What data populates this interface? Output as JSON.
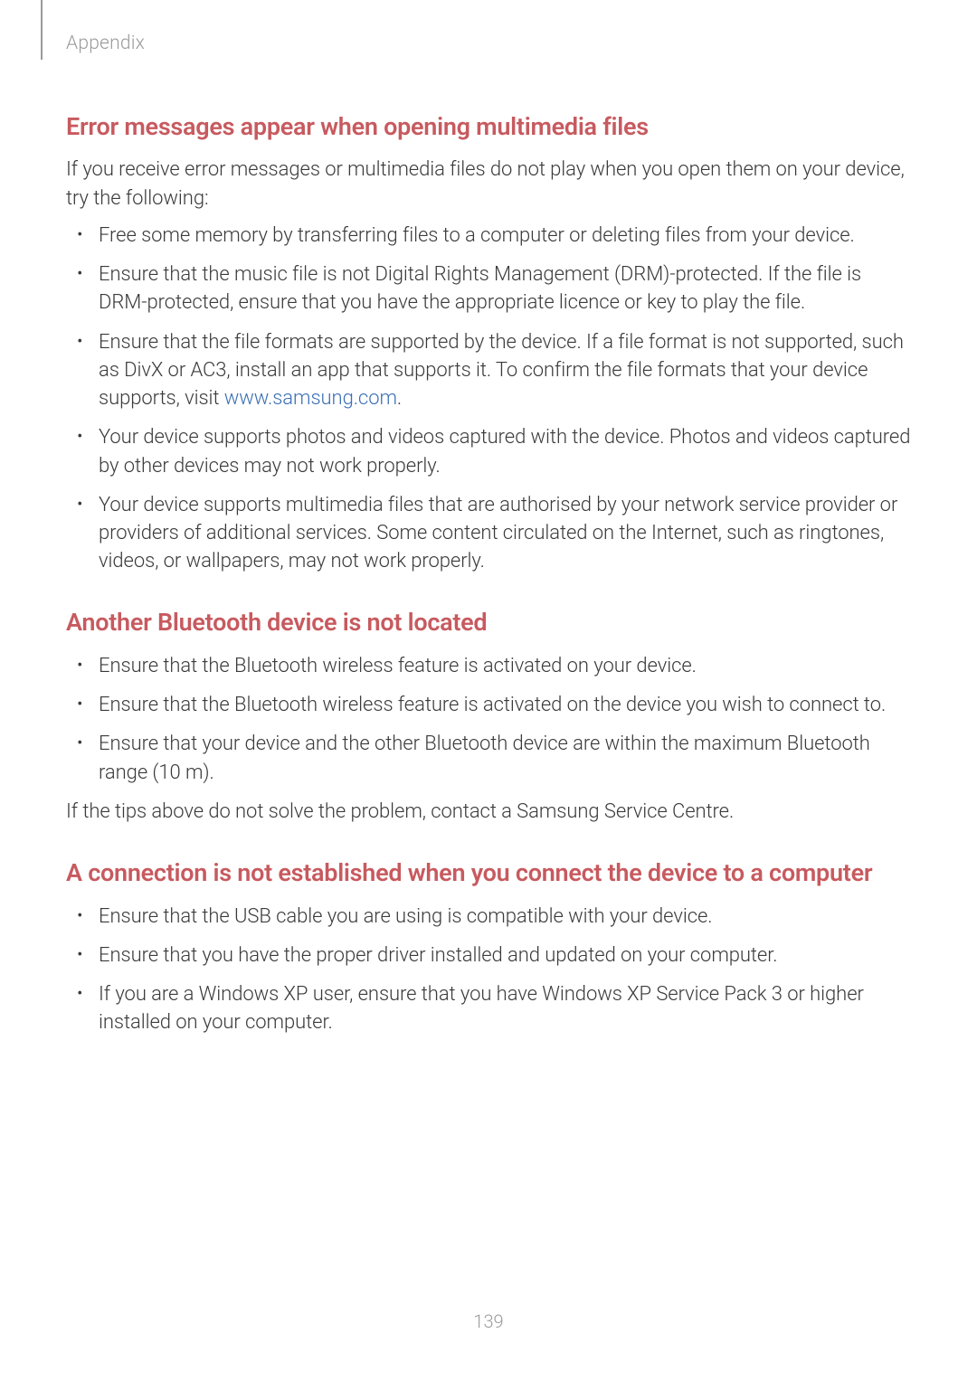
{
  "header": {
    "section_label": "Appendix"
  },
  "page_number": "139",
  "sections": [
    {
      "heading": "Error messages appear when opening multimedia files",
      "intro": "If you receive error messages or multimedia files do not play when you open them on your device, try the following:",
      "bullets": [
        {
          "text": "Free some memory by transferring files to a computer or deleting files from your device."
        },
        {
          "text": "Ensure that the music file is not Digital Rights Management (DRM)-protected. If the file is DRM-protected, ensure that you have the appropriate licence or key to play the file."
        },
        {
          "pre": "Ensure that the file formats are supported by the device. If a file format is not supported, such as DivX or AC3, install an app that supports it. To confirm the file formats that your device supports, visit ",
          "link_text": "www.samsung.com",
          "post": "."
        },
        {
          "text": "Your device supports photos and videos captured with the device. Photos and videos captured by other devices may not work properly."
        },
        {
          "text": "Your device supports multimedia files that are authorised by your network service provider or providers of additional services. Some content circulated on the Internet, such as ringtones, videos, or wallpapers, may not work properly."
        }
      ]
    },
    {
      "heading": "Another Bluetooth device is not located",
      "bullets": [
        {
          "text": "Ensure that the Bluetooth wireless feature is activated on your device."
        },
        {
          "text": "Ensure that the Bluetooth wireless feature is activated on the device you wish to connect to."
        },
        {
          "text": "Ensure that your device and the other Bluetooth device are within the maximum Bluetooth range (10 m)."
        }
      ],
      "outro": "If the tips above do not solve the problem, contact a Samsung Service Centre."
    },
    {
      "heading": "A connection is not established when you connect the device to a computer",
      "bullets": [
        {
          "text": "Ensure that the USB cable you are using is compatible with your device."
        },
        {
          "text": "Ensure that you have the proper driver installed and updated on your computer."
        },
        {
          "text": "If you are a Windows XP user, ensure that you have Windows XP Service Pack 3 or higher installed on your computer."
        }
      ]
    }
  ]
}
